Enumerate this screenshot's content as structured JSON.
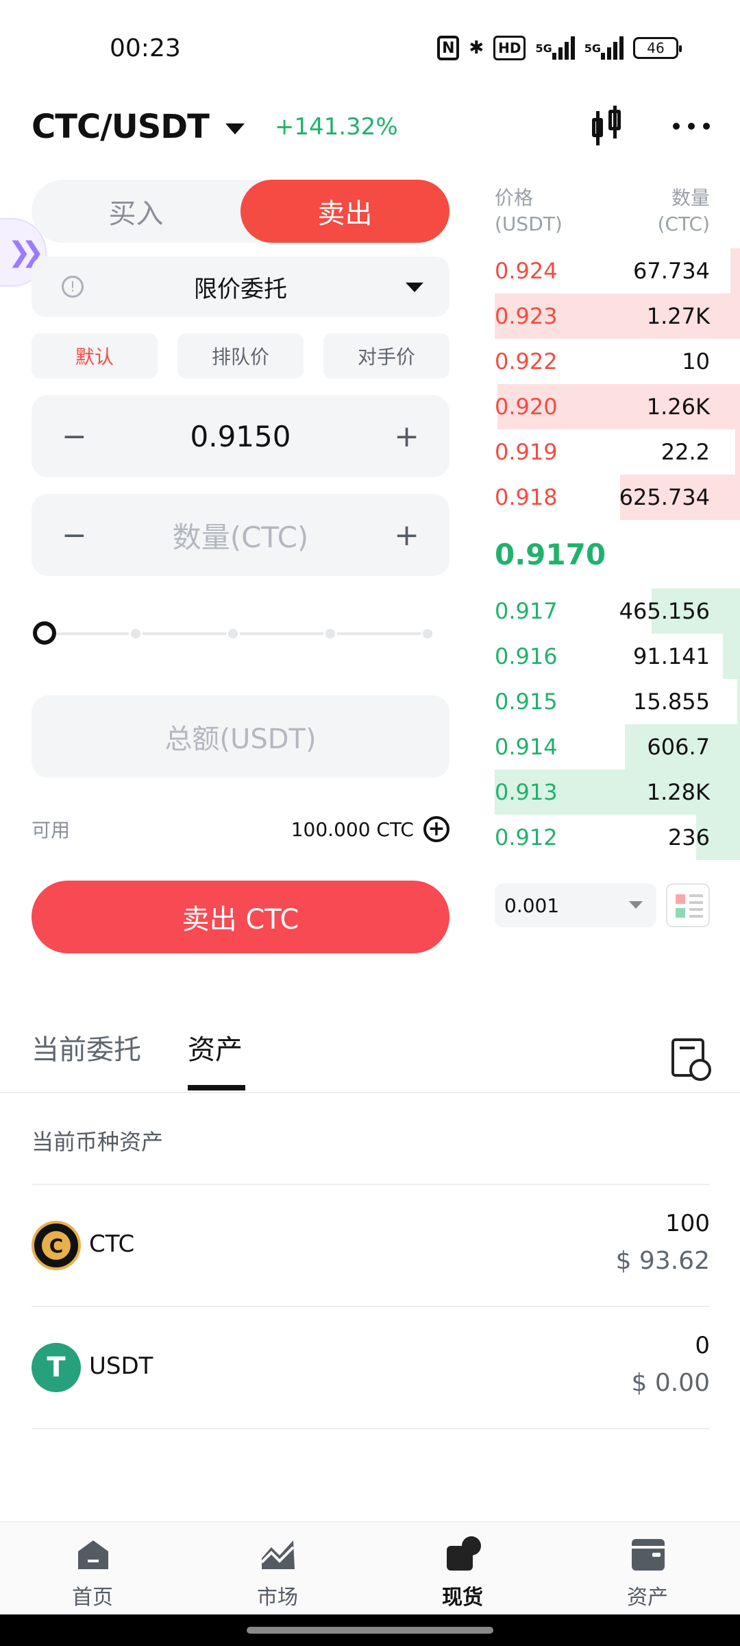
{
  "status": {
    "time": "00:23",
    "network_a": "5G",
    "network_b": "5G",
    "hd": "HD",
    "battery": "46"
  },
  "header": {
    "pair": "CTC/USDT",
    "change": "+141.32%"
  },
  "form": {
    "buy_label": "买入",
    "sell_label": "卖出",
    "order_type": "限价委托",
    "price_buttons": [
      "默认",
      "排队价",
      "对手价"
    ],
    "price_value": "0.9150",
    "minus": "−",
    "plus": "+",
    "qty_placeholder": "数量(CTC)",
    "total_placeholder": "总额(USDT)",
    "available_label": "可用",
    "available_value": "100.000 CTC",
    "add_symbol": "+",
    "submit_label": "卖出 CTC",
    "slider_level": 0
  },
  "book": {
    "price_header": "价格",
    "price_unit": "(USDT)",
    "qty_header": "数量",
    "qty_unit": "(CTC)",
    "asks": [
      {
        "price": "0.924",
        "qty": "67.734",
        "depth": 0.04
      },
      {
        "price": "0.923",
        "qty": "1.27K",
        "depth": 1.0
      },
      {
        "price": "0.922",
        "qty": "10",
        "depth": 0.0
      },
      {
        "price": "0.920",
        "qty": "1.26K",
        "depth": 0.99
      },
      {
        "price": "0.919",
        "qty": "22.2",
        "depth": 0.02
      },
      {
        "price": "0.918",
        "qty": "625.734",
        "depth": 0.49
      }
    ],
    "last_price": "0.9170",
    "bids": [
      {
        "price": "0.917",
        "qty": "465.156",
        "depth": 0.36
      },
      {
        "price": "0.916",
        "qty": "91.141",
        "depth": 0.07
      },
      {
        "price": "0.915",
        "qty": "15.855",
        "depth": 0.01
      },
      {
        "price": "0.914",
        "qty": "606.7",
        "depth": 0.47
      },
      {
        "price": "0.913",
        "qty": "1.28K",
        "depth": 1.0
      },
      {
        "price": "0.912",
        "qty": "236",
        "depth": 0.18
      }
    ],
    "precision": "0.001"
  },
  "tabs": {
    "open_orders": "当前委托",
    "assets": "资产"
  },
  "assets": {
    "title": "当前币种资产",
    "items": [
      {
        "name": "CTC",
        "amount": "100",
        "usd": "$ 93.62"
      },
      {
        "name": "USDT",
        "amount": "0",
        "usd": "$ 0.00"
      }
    ]
  },
  "nav": {
    "items": [
      {
        "label": "首页",
        "icon": "home-icon"
      },
      {
        "label": "市场",
        "icon": "market-chart-icon"
      },
      {
        "label": "现货",
        "icon": "spot-icon",
        "active": true
      },
      {
        "label": "资产",
        "icon": "wallet-icon"
      }
    ]
  },
  "colors": {
    "sell": "#f44b42",
    "buy": "#20b26c",
    "ask_bar": "#fde0e0",
    "bid_bar": "#daf3e5"
  }
}
